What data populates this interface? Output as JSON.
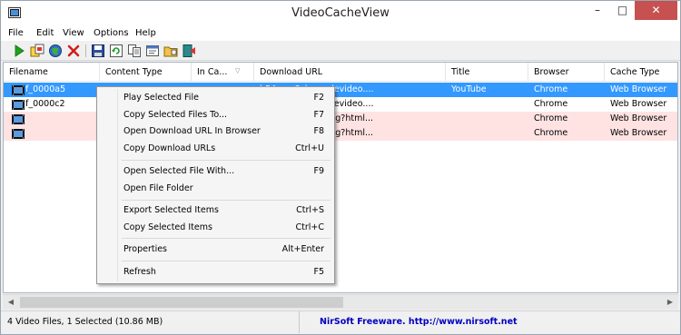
{
  "window": {
    "title": "VideoCacheView",
    "minimize_glyph": "–",
    "maximize_glyph": "□",
    "close_glyph": "✕"
  },
  "menu": [
    "File",
    "Edit",
    "View",
    "Options",
    "Help"
  ],
  "toolbar": {
    "icons": [
      "play-icon",
      "copy-files-icon",
      "open-browser-icon",
      "delete-icon",
      "save-icon",
      "refresh-icon",
      "copy-icon",
      "properties-icon",
      "open-folder-icon",
      "exit-icon"
    ]
  },
  "columns": [
    "Filename",
    "Content Type",
    "In Ca...",
    "Download URL",
    "Title",
    "Browser",
    "Cache Type"
  ],
  "rows": [
    {
      "filename": "f_0000a5",
      "content_type": "",
      "in_cache": "",
      "download_url": "b54vo-v8cl.googlevideo....",
      "title": "YouTube",
      "browser": "Chrome",
      "cache_type": "Web Browser"
    },
    {
      "filename": "f_0000c2",
      "content_type": "",
      "in_cache": "",
      "download_url": "b54vo-v8cl.googlevideo....",
      "title": "",
      "browser": "Chrome",
      "cache_type": "Web Browser"
    },
    {
      "filename": "",
      "content_type": "",
      "in_cache": "",
      "download_url": "ube.com/ptracking?html...",
      "title": "",
      "browser": "Chrome",
      "cache_type": "Web Browser"
    },
    {
      "filename": "",
      "content_type": "",
      "in_cache": "",
      "download_url": "ube.com/ptracking?html...",
      "title": "",
      "browser": "Chrome",
      "cache_type": "Web Browser"
    }
  ],
  "context_menu": [
    {
      "label": "Play Selected File",
      "shortcut": "F2"
    },
    {
      "label": "Copy Selected Files To...",
      "shortcut": "F7"
    },
    {
      "label": "Open Download URL In Browser",
      "shortcut": "F8"
    },
    {
      "label": "Copy Download URLs",
      "shortcut": "Ctrl+U"
    },
    {
      "label": "Open Selected File With...",
      "shortcut": "F9"
    },
    {
      "label": "Open File Folder",
      "shortcut": ""
    },
    {
      "label": "Export Selected Items",
      "shortcut": "Ctrl+S"
    },
    {
      "label": "Copy Selected Items",
      "shortcut": "Ctrl+C"
    },
    {
      "label": "Properties",
      "shortcut": "Alt+Enter"
    },
    {
      "label": "Refresh",
      "shortcut": "F5"
    }
  ],
  "status": {
    "summary": "4 Video Files, 1 Selected  (10.86 MB)",
    "link": "NirSoft Freeware.  http://www.nirsoft.net"
  },
  "colors": {
    "selection": "#3399ff",
    "highlight_row": "#ffe3e3",
    "link": "#0000c0",
    "close_button": "#c75050"
  }
}
